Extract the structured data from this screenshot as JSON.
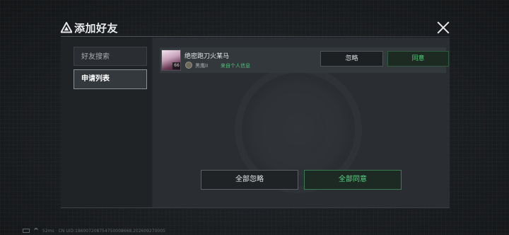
{
  "dialog": {
    "title": "添加好友",
    "title_icon": "warning-triangle-icon",
    "close_icon": "close-icon"
  },
  "sidebar": {
    "tabs": [
      {
        "label": "好友搜索",
        "active": false
      },
      {
        "label": "申请列表",
        "active": true
      }
    ]
  },
  "requests": [
    {
      "avatar_level": "66",
      "name": "绝密跑刀火某马",
      "rank_icon": "rank-badge-icon",
      "rank": "黑鹰II",
      "source": "来自个人信息",
      "ignore_label": "忽略",
      "accept_label": "同意"
    }
  ],
  "actions": {
    "ignore_all_label": "全部忽略",
    "accept_all_label": "全部同意"
  },
  "status_bar": {
    "ping": "52ms",
    "uid_text": "CN UID:1860072087547500086​68,202609270005"
  },
  "colors": {
    "accent_green": "#4fd17c",
    "panel_bg": "#24282c",
    "page_bg": "#1a1d20"
  }
}
